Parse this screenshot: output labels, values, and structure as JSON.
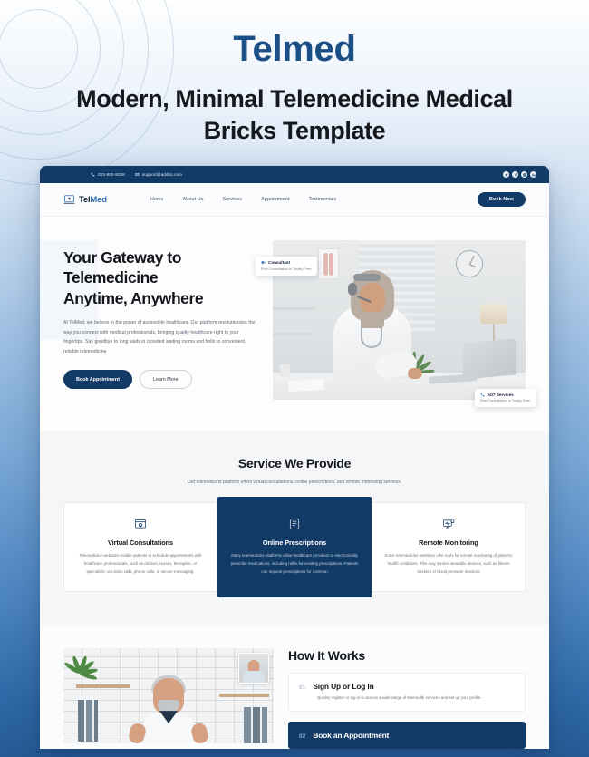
{
  "showcase": {
    "brand": "Telmed",
    "subtitle": "Modern, Minimal Telemedicine Medical Bricks Template"
  },
  "site": {
    "topbar": {
      "phone": "023-900-8338",
      "email": "support@addito.com",
      "socials": [
        "twitter-icon",
        "facebook-icon",
        "instagram-icon",
        "linkedin-icon"
      ]
    },
    "nav": {
      "logo_part1": "Tel",
      "logo_part2": "Med",
      "links": [
        "Home",
        "About Us",
        "Services",
        "Appointment",
        "Testimonials"
      ],
      "cta": "Book Now"
    },
    "hero": {
      "heading_line1": "Your Gateway to",
      "heading_line2": "Telemedicine",
      "heading_line3": "Anytime, Anywhere",
      "paragraph": "At TelMed, we believe in the power of accessible healthcare. Our platform revolutionizes the way you connect with medical professionals, bringing quality healthcare right to your fingertips. Say goodbye to long waits in crowded waiting rooms and hello to convenient, reliable telemedicine",
      "btn_primary": "Book Appointment",
      "btn_secondary": "Learn More",
      "badge_top": {
        "title": "Consultant",
        "text": "First Consultation is Totally Free.",
        "icon": "video-consult-icon"
      },
      "badge_bottom": {
        "title": "24/7 Services",
        "text": "First Consultation is Totally Free.",
        "icon": "phone-icon"
      }
    },
    "services": {
      "title": "Service We Provide",
      "subtitle": "Our telemedicine platform offers virtual consultations, online prescriptions, and remote monitoring services.",
      "cards": [
        {
          "icon": "video-call-icon",
          "title": "Virtual Consultations",
          "text": "Telemedicine websites enable patients to schedule appointments with healthcare professionals, such as doctors, nurses, therapists, or specialists, via video calls, phone calls, or secure messaging."
        },
        {
          "icon": "prescription-icon",
          "title": "Online Prescriptions",
          "text": "Many telemedicine platforms allow healthcare providers to electronically prescribe medications, including refills for existing prescriptions. Patients can request prescriptions for common"
        },
        {
          "icon": "monitor-heart-icon",
          "title": "Remote Monitoring",
          "text": "Some telemedicine websites offer tools for remote monitoring of patients' health conditions. This may involve wearable devices, such as fitness trackers or blood pressure monitors"
        }
      ]
    },
    "how_it_works": {
      "title": "How It Works",
      "steps": [
        {
          "number": "01",
          "title": "Sign Up or Log In",
          "text": "Quickly register or log in to access a wide range of telehealth services and set up your profile."
        },
        {
          "number": "02",
          "title": "Book an Appointment",
          "text": ""
        }
      ]
    }
  },
  "colors": {
    "brand_navy": "#123a67",
    "brand_blue": "#2f6fb5",
    "title_blue": "#1c4f86",
    "page_bg_top": "#fdfefe",
    "page_bg_bottom": "#255b95"
  }
}
